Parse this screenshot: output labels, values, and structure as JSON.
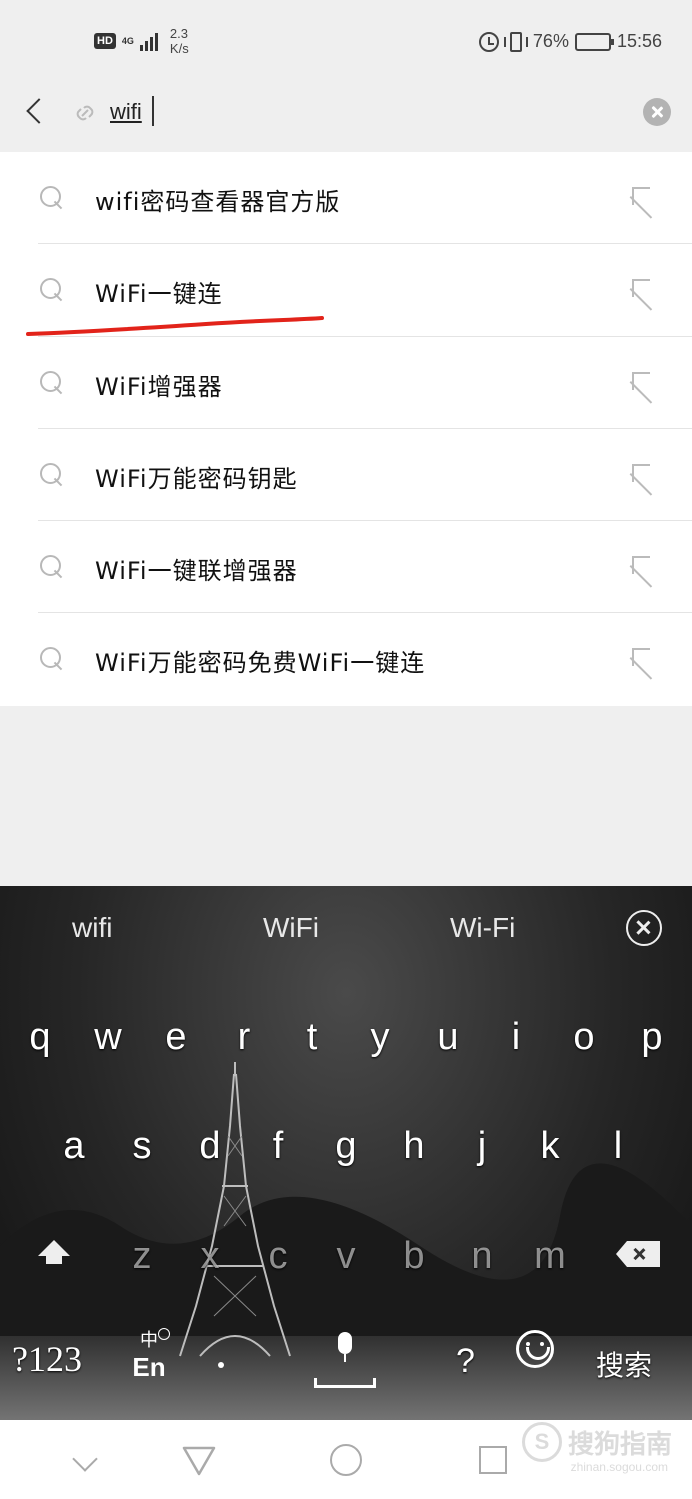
{
  "status_bar": {
    "hd": "HD",
    "network": "4G",
    "speed_value": "2.3",
    "speed_unit": "K/s",
    "battery": "76%",
    "time": "15:56",
    "battery_level": 0.76
  },
  "search": {
    "query": "wifi"
  },
  "suggestions": [
    {
      "text": "wifi密码查看器官方版"
    },
    {
      "text": "WiFi一键连"
    },
    {
      "text": "WiFi增强器"
    },
    {
      "text": "WiFi万能密码钥匙"
    },
    {
      "text": "WiFi一键联增强器"
    },
    {
      "text": "WiFi万能密码免费WiFi一键连"
    }
  ],
  "annotation_color": "#e2231a",
  "keyboard": {
    "candidates": [
      "wifi",
      "WiFi",
      "Wi-Fi"
    ],
    "row1": [
      "q",
      "w",
      "e",
      "r",
      "t",
      "y",
      "u",
      "i",
      "o",
      "p"
    ],
    "row2": [
      "a",
      "s",
      "d",
      "f",
      "g",
      "h",
      "j",
      "k",
      "l"
    ],
    "row3": [
      "z",
      "x",
      "c",
      "v",
      "b",
      "n",
      "m"
    ],
    "numbers_key": "?123",
    "lang_zh": "中",
    "lang_en": "En",
    "question_key": "?",
    "search_key": "搜索"
  },
  "watermark": {
    "text": "搜狗指南",
    "url": "zhinan.sogou.com"
  }
}
